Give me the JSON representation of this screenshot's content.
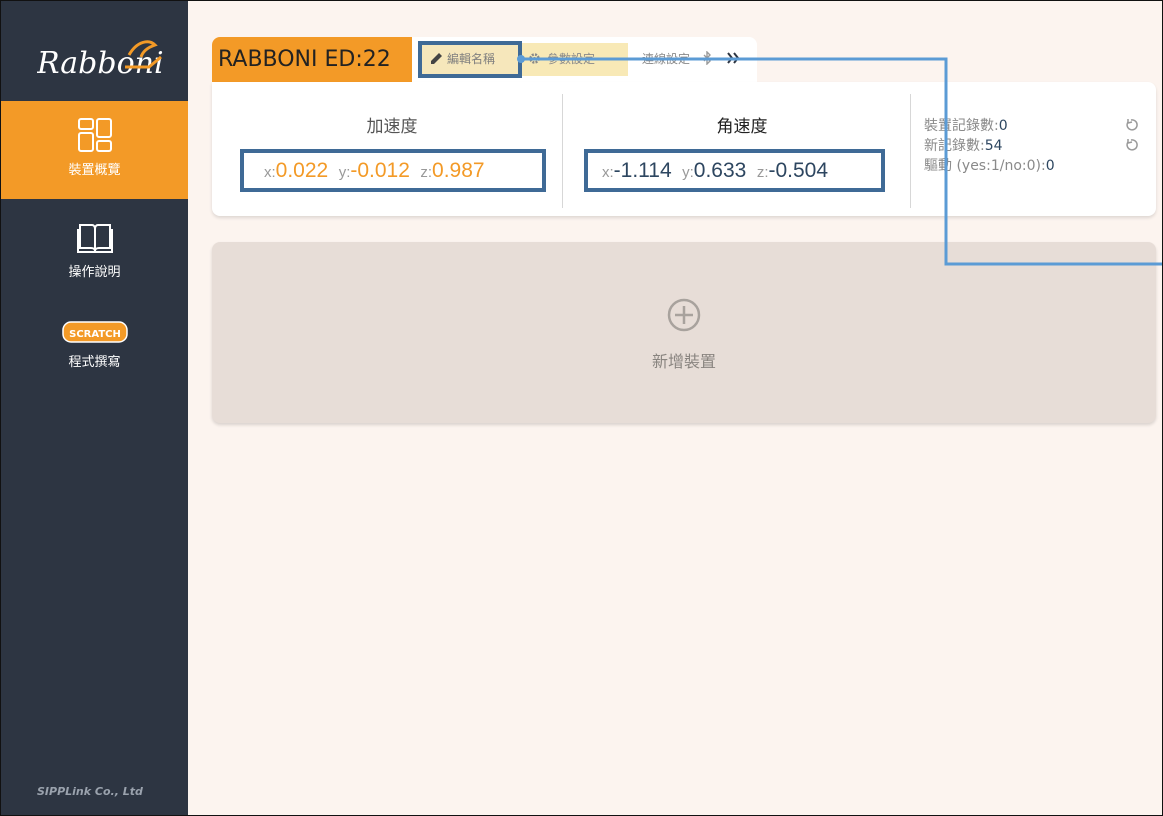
{
  "sidebar": {
    "logo_text": "Rabboni",
    "items": [
      {
        "label": "裝置概覽",
        "icon": "dashboard-grid-icon",
        "active": true
      },
      {
        "label": "操作說明",
        "icon": "book-icon",
        "active": false
      },
      {
        "label": "程式撰寫",
        "icon": "scratch-logo",
        "badge": "SCRATCH",
        "active": false
      }
    ],
    "footer": "SIPPLink Co., Ltd"
  },
  "device": {
    "name": "RABBONI ED:22",
    "tabs": {
      "edit_name": "編輯名稱",
      "params": "參數設定",
      "connect": "連線設定"
    }
  },
  "acceleration": {
    "title": "加速度",
    "x_label": "x:",
    "x": "0.022",
    "y_label": "y:",
    "y": "-0.012",
    "z_label": "z:",
    "z": "0.987"
  },
  "gyro": {
    "title": "角速度",
    "x_label": "x:",
    "x": "-1.114",
    "y_label": "y:",
    "y": "0.633",
    "z_label": "z:",
    "z": "-0.504"
  },
  "stats": {
    "device_records_label": "裝置記錄數:",
    "device_records": "0",
    "new_records_label": "新記錄數:",
    "new_records": "54",
    "driver_label": "驅動 (yes:1/no:0):",
    "driver": "0"
  },
  "add_device": {
    "label": "新增裝置"
  },
  "colors": {
    "accent": "#f39a27",
    "sidebar_bg": "#2d3542",
    "main_bg": "#fcf4ef",
    "highlight_border": "#3f6a96"
  }
}
